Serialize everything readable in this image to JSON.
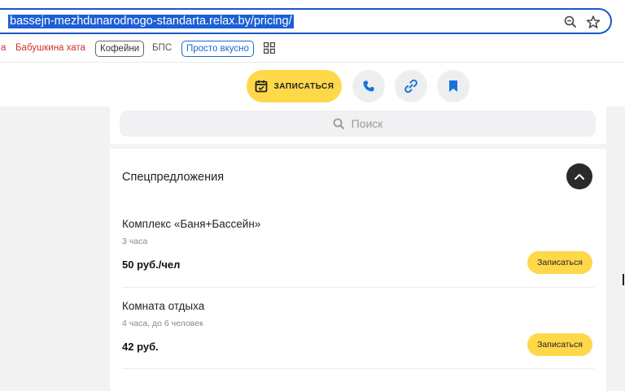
{
  "browser": {
    "url": "bassejn-mezhdunarodnogo-standarta.relax.by/pricing/",
    "icons": [
      "zoom-icon",
      "star-icon"
    ],
    "bookmarks": [
      {
        "label": "а",
        "style": "red"
      },
      {
        "label": "Бабушкина хата",
        "style": "red"
      },
      {
        "label": "Кофейни",
        "style": "outlined"
      },
      {
        "label": "БПС",
        "style": "plain"
      },
      {
        "label": "Просто вкусно",
        "style": "blue"
      }
    ],
    "apps_icon": "apps-grid-icon"
  },
  "header": {
    "book_button_label": "ЗАПИСАТЬСЯ",
    "icons": [
      "calendar-icon",
      "phone-icon",
      "link-icon",
      "bookmark-icon"
    ],
    "accent_color": "#ffd84a",
    "icon_color": "#1a73d9"
  },
  "search": {
    "placeholder": "Поиск"
  },
  "section": {
    "title": "Спецпредложения",
    "collapse_icon": "chevron-up-icon"
  },
  "offers": [
    {
      "name": "Комплекс «Баня+Бассейн»",
      "meta": "3 часа",
      "price": "50 руб./чел",
      "button": "Записаться"
    },
    {
      "name": "Комната отдыха",
      "meta": "4 часа, до 6 человек",
      "price": "42 руб.",
      "button": "Записаться"
    }
  ]
}
